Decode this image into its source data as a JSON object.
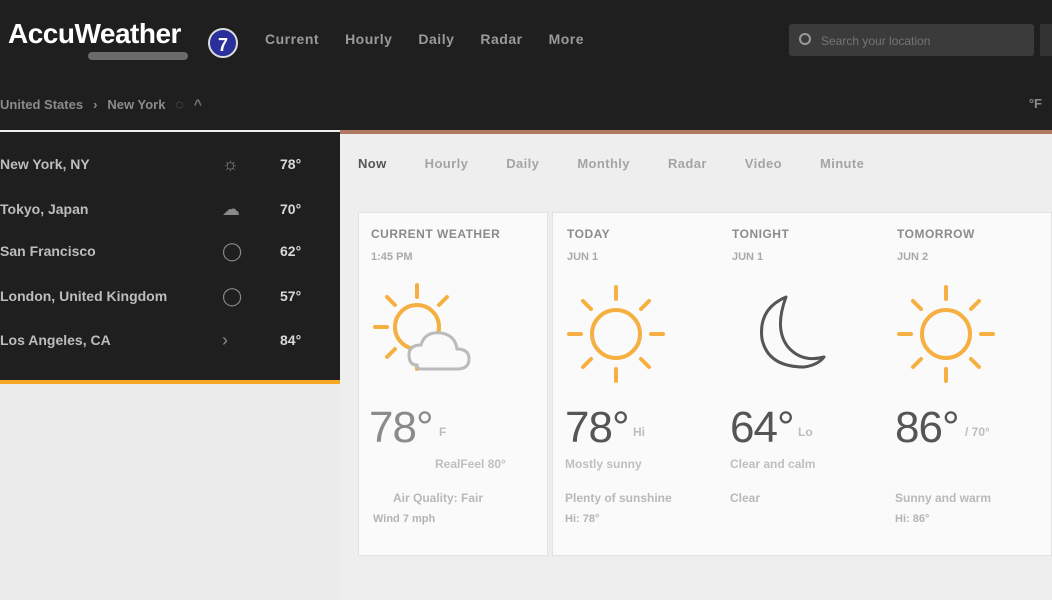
{
  "header": {
    "logo": "AccuWeather",
    "badge": "7",
    "nav": [
      "Current",
      "Hourly",
      "Daily",
      "Radar",
      "More"
    ],
    "search_placeholder": "Search your location"
  },
  "breadcrumb": {
    "items": [
      "United States",
      "New York"
    ],
    "unit_selector": "°F"
  },
  "recent_locations": [
    {
      "city": "New York, NY",
      "icon": "partly-cloudy-icon",
      "temp": "78°"
    },
    {
      "city": "Tokyo, Japan",
      "icon": "cloudy-icon",
      "temp": "70°"
    },
    {
      "city": "San Francisco",
      "icon": "cloud-icon",
      "temp": "62°"
    },
    {
      "city": "London, United Kingdom",
      "icon": "cloud-icon",
      "temp": "57°"
    },
    {
      "city": "Los Angeles, CA",
      "icon": "clear-icon",
      "temp": "84°"
    }
  ],
  "tabs": [
    "Now",
    "Hourly",
    "Daily",
    "Monthly",
    "Radar",
    "Video",
    "Minute"
  ],
  "current": {
    "label": "CURRENT WEATHER",
    "time": "1:45 PM",
    "temp": "78°",
    "unit": "F",
    "realfeel": "RealFeel 80°",
    "air_quality": "Air Quality: Fair",
    "wind": "Wind 7 mph"
  },
  "forecast": [
    {
      "label": "TODAY",
      "date": "JUN 1",
      "temp": "78°",
      "unit": "Hi",
      "desc": "Mostly sunny",
      "detail": "Plenty of sunshine",
      "extra": "Hi: 78°"
    },
    {
      "label": "TONIGHT",
      "date": "JUN 1",
      "temp": "64°",
      "unit": "Lo",
      "desc": "Clear and calm",
      "detail": "Clear",
      "extra": ""
    },
    {
      "label": "TOMORROW",
      "date": "JUN 2",
      "temp": "86°",
      "unit": "/ 70°",
      "desc": "",
      "detail": "Sunny and warm",
      "extra": "Hi: 86°"
    }
  ]
}
